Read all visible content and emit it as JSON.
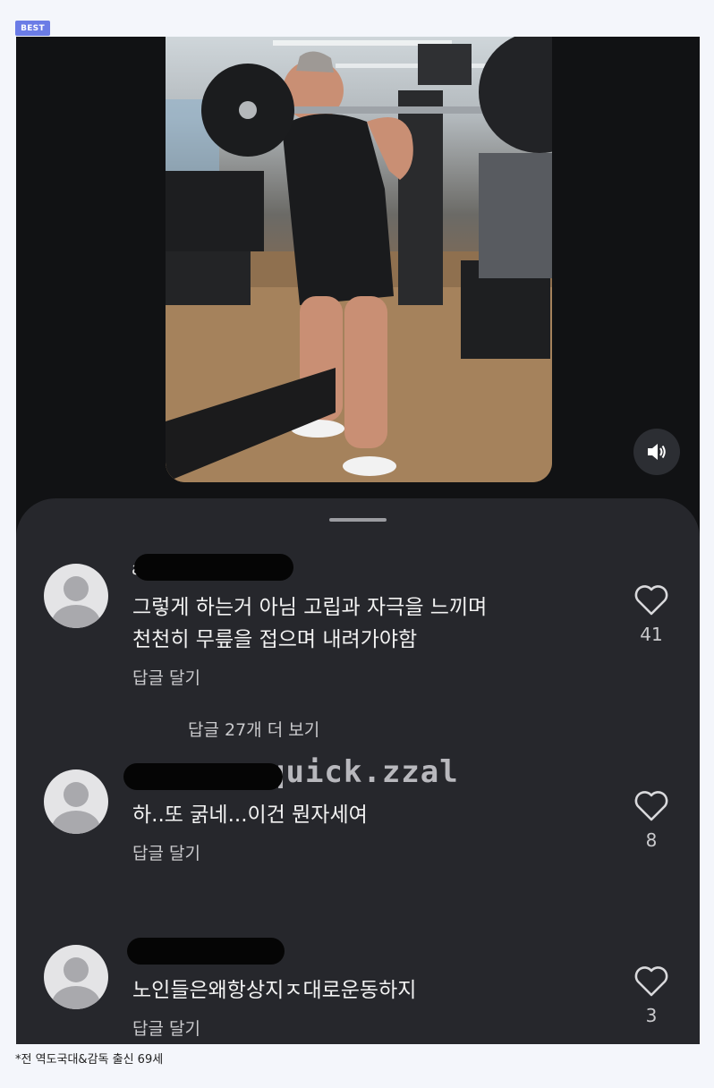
{
  "badge": "BEST",
  "sheet": {
    "more_replies": "답글 27개 더 보기",
    "watermark": "quick.zzal"
  },
  "comments": [
    {
      "username_initial": "a",
      "lines": [
        "그렇게 하는거 아님 고립과 자극을 느끼며",
        "천천히 무릎을 접으며 내려가야함"
      ],
      "reply_label": "답글 달기",
      "likes": "41"
    },
    {
      "username_initial": "",
      "lines": [
        "하..또 굵네...이건 뭔자세여"
      ],
      "reply_label": "답글 달기",
      "likes": "8"
    },
    {
      "username_initial": "",
      "lines": [
        "노인들은왜항상지ㅈ대로운동하지"
      ],
      "reply_label": "답글 달기",
      "likes": "3"
    }
  ],
  "caption": "*전 역도국대&감독 출신 69세",
  "icons": {
    "sound": "speaker-icon",
    "like": "heart-icon",
    "avatar": "default-user-icon"
  },
  "colors": {
    "badge": "#6b7ce6",
    "sheet": "#26272c",
    "background": "#111214"
  }
}
